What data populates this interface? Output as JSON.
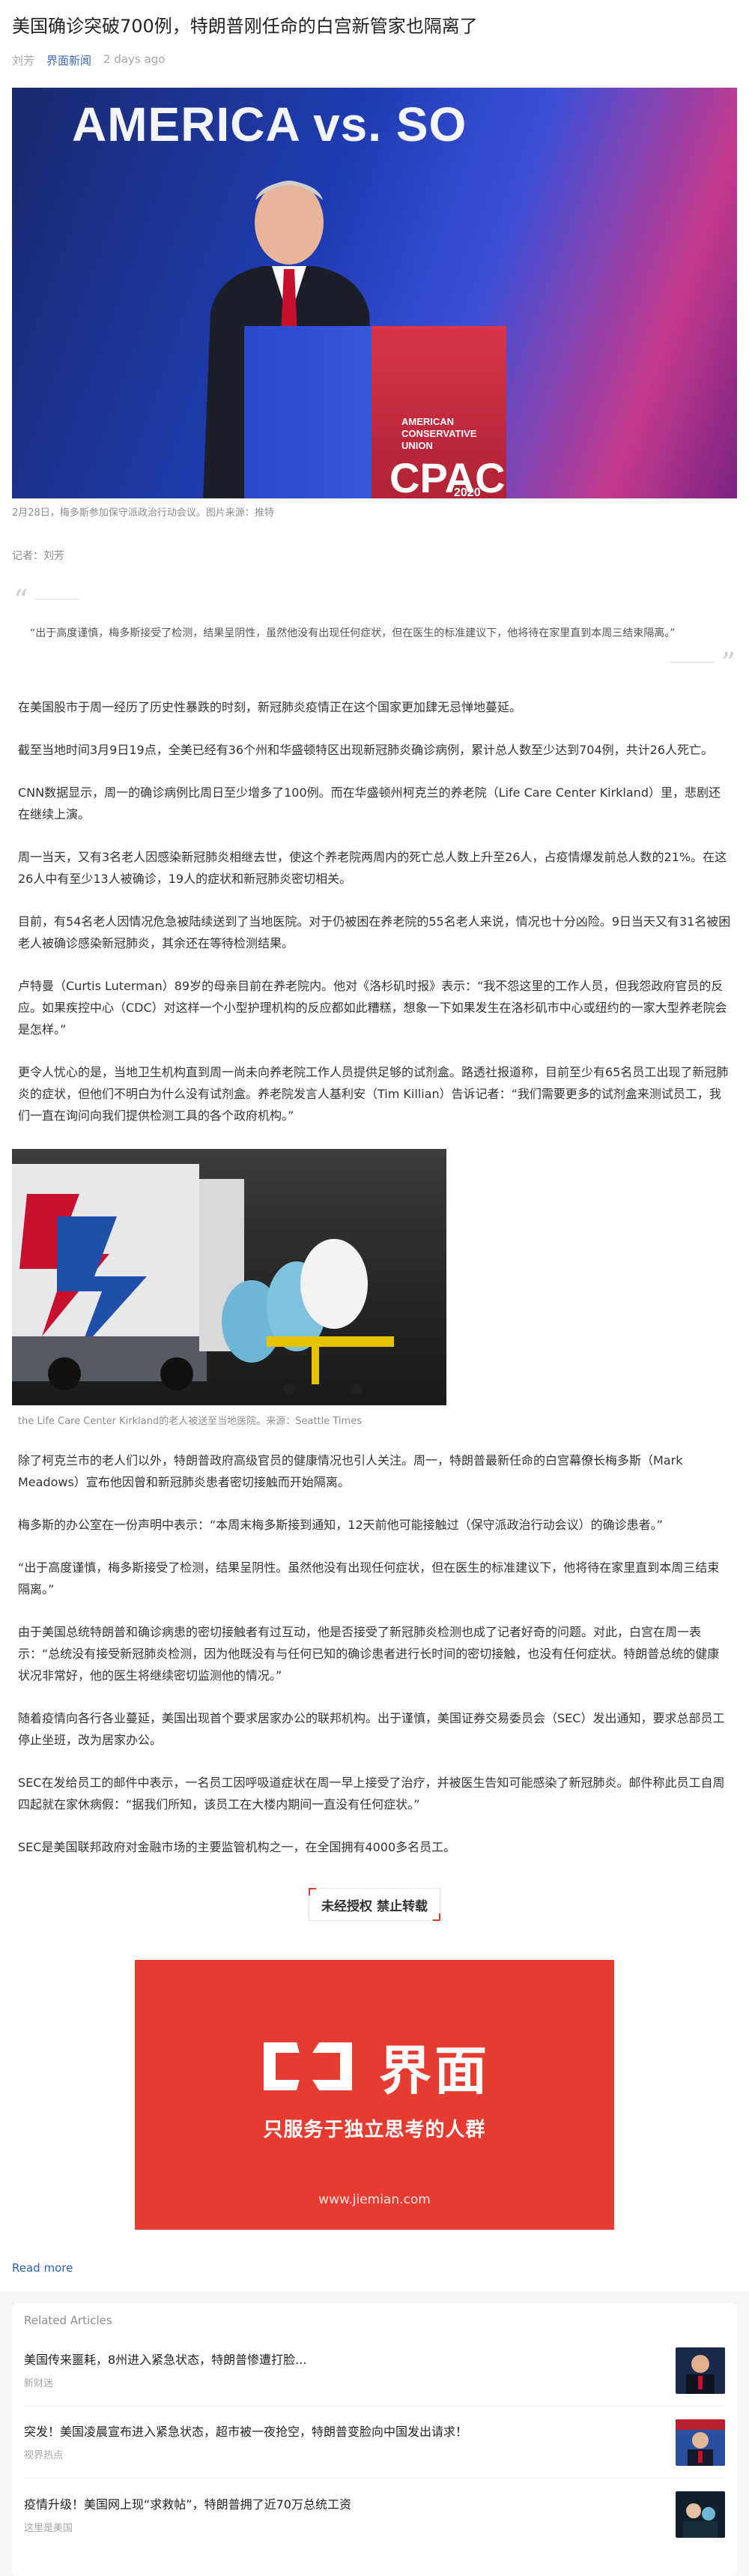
{
  "article": {
    "title": "美国确诊突破700例，特朗普刚任命的白宫新管家也隔离了",
    "author": "刘芳",
    "source": "界面新闻",
    "time": "2 days ago"
  },
  "hero": {
    "banner_text": "AMERICA vs. SO",
    "podium_small": "AMERICAN CONSERVATIVE UNION",
    "podium_big": "CPAC",
    "podium_year": "2020",
    "caption": "2月28日，梅多斯参加保守派政治行动会议。图片来源：推特"
  },
  "byline": "记者：刘芳",
  "quote": "“出于高度谨慎，梅多斯接受了检测，结果呈阴性，虽然他没有出现任何症状，但在医生的标准建议下，他将待在家里直到本周三结束隔离。”",
  "paragraphs_a": [
    "在美国股市于周一经历了历史性暴跌的时刻，新冠肺炎疫情正在这个国家更加肆无忌惮地蔓延。",
    "截至当地时间3月9日19点，全美已经有36个州和华盛顿特区出现新冠肺炎确诊病例，累计总人数至少达到704例，共计26人死亡。",
    "CNN数据显示，周一的确诊病例比周日至少增多了100例。而在华盛顿州柯克兰的养老院（Life Care Center Kirkland）里，悲剧还在继续上演。",
    "周一当天，又有3名老人因感染新冠肺炎相继去世，使这个养老院两周内的死亡总人数上升至26人，占疫情爆发前总人数的21%。在这26人中有至少13人被确诊，19人的症状和新冠肺炎密切相关。",
    "目前，有54名老人因情况危急被陆续送到了当地医院。对于仍被困在养老院的55名老人来说，情况也十分凶险。9日当天又有31名被困老人被确诊感染新冠肺炎，其余还在等待检测结果。",
    "卢特曼（Curtis Luterman）89岁的母亲目前在养老院内。他对《洛杉矶时报》表示：“我不怨这里的工作人员，但我怨政府官员的反应。如果疾控中心（CDC）对这样一个小型护理机构的反应都如此糟糕，想象一下如果发生在洛杉矶市中心或纽约的一家大型养老院会是怎样。”",
    "更令人忧心的是，当地卫生机构直到周一尚未向养老院工作人员提供足够的试剂盒。路透社报道称，目前至少有65名员工出现了新冠肺炎的症状，但他们不明白为什么没有试剂盒。养老院发言人基利安（Tim Killian）告诉记者：“我们需要更多的试剂盒来测试员工，我们一直在询问向我们提供检测工具的各个政府机构。”"
  ],
  "photo2_caption": "the Life Care Center Kirkland的老人被送至当地医院。来源：Seattle Times",
  "paragraphs_b": [
    "除了柯克兰市的老人们以外，特朗普政府高级官员的健康情况也引人关注。周一，特朗普最新任命的白宫幕僚长梅多斯（Mark Meadows）宣布他因曾和新冠肺炎患者密切接触而开始隔离。",
    "梅多斯的办公室在一份声明中表示：“本周末梅多斯接到通知，12天前他可能接触过（保守派政治行动会议）的确诊患者。”",
    "“出于高度谨慎，梅多斯接受了检测，结果呈阴性。虽然他没有出现任何症状，但在医生的标准建议下，他将待在家里直到本周三结束隔离。”",
    "由于美国总统特朗普和确诊病患的密切接触者有过互动，他是否接受了新冠肺炎检测也成了记者好奇的问题。对此，白宫在周一表示：“总统没有接受新冠肺炎检测，因为他既没有与任何已知的确诊患者进行长时间的密切接触，也没有任何症状。特朗普总统的健康状况非常好，他的医生将继续密切监测他的情况。”",
    "随着疫情向各行各业蔓延，美国出现首个要求居家办公的联邦机构。出于谨慎，美国证券交易委员会（SEC）发出通知，要求总部员工停止坐班，改为居家办公。",
    "SEC在发给员工的邮件中表示，一名员工因呼吸道症状在周一早上接受了治疗，并被医生告知可能感染了新冠肺炎。邮件称此员工自周四起就在家休病假：“据我们所知，该员工在大楼内期间一直没有任何症状。”",
    "SEC是美国联邦政府对金融市场的主要监管机构之一，在全国拥有4000多名员工。"
  ],
  "notice": "未经授权 禁止转载",
  "ad": {
    "brand": "界面",
    "slogan": "只服务于独立思考的人群",
    "url": "www.jiemian.com",
    "bg_color": "#e63b31"
  },
  "read_more": "Read more",
  "related": {
    "title": "Related Articles",
    "items": [
      {
        "headline": "美国传来噩耗，8州进入紧急状态，特朗普惨遭打脸...",
        "source": "新财迷"
      },
      {
        "headline": "突发！美国凌晨宣布进入紧急状态，超市被一夜抢空，特朗普变脸向中国发出请求！",
        "source": "视界热点"
      },
      {
        "headline": "疫情升级！美国网上现“求救帖”，特朗普拥了近70万总统工资",
        "source": "这里是美国"
      }
    ]
  }
}
